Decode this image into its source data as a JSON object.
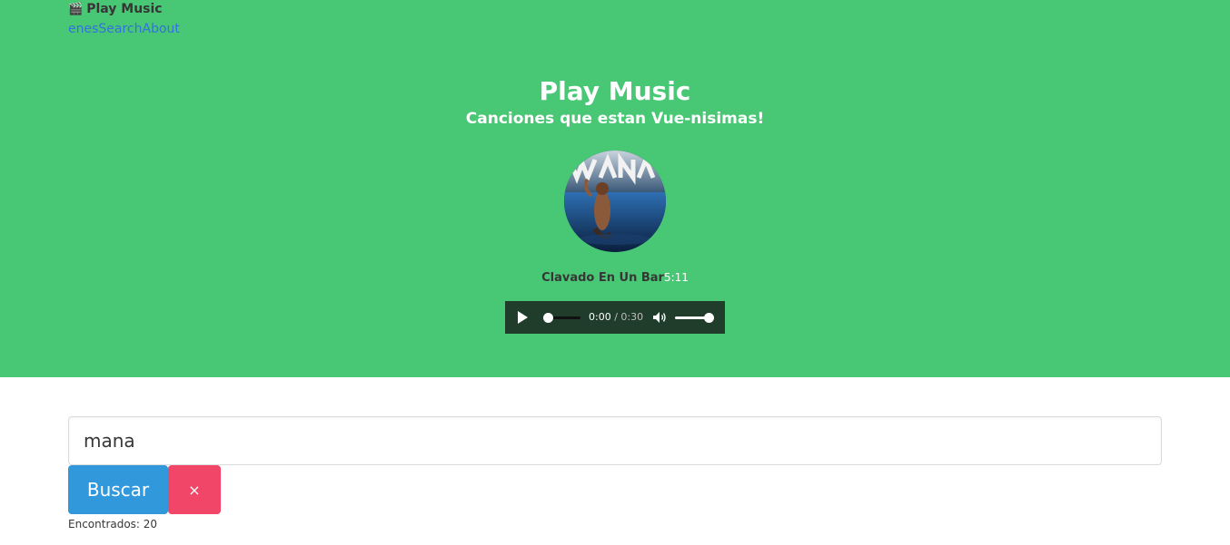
{
  "nav": {
    "brand_icon": "🎬",
    "brand_text": "Play Music",
    "links": [
      "enes",
      "Search",
      "About"
    ]
  },
  "hero": {
    "title": "Play Music",
    "subtitle": "Canciones que estan Vue-nisimas!",
    "cover_icon": "album-cover-image",
    "track_name": "Clavado En Un Bar",
    "track_duration": "5:11"
  },
  "player": {
    "current_time": "0:00",
    "separator": " / ",
    "total_time": "0:30",
    "progress_fraction": 0,
    "volume_fraction": 1
  },
  "search": {
    "value": "mana",
    "button_label": "Buscar",
    "clear_label": "×",
    "found_text": "Encontrados: 20"
  },
  "colors": {
    "hero_bg": "#48c774",
    "search_button": "#3298dc",
    "clear_button": "#f14668",
    "link": "#3273dc"
  }
}
